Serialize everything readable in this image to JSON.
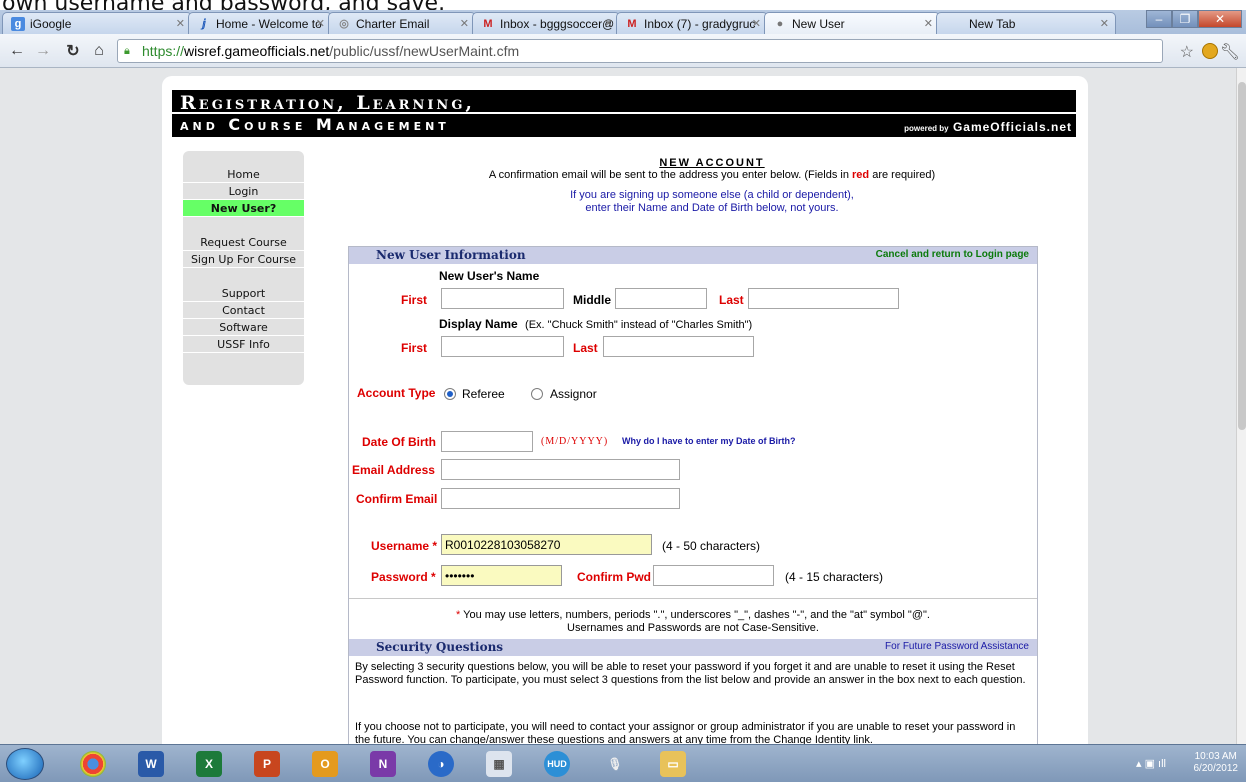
{
  "top_caption": "own username and password, and save.",
  "browser": {
    "tabs": [
      {
        "label": "iGoogle",
        "icon": "igoogle-icon",
        "active": false
      },
      {
        "label": "Home - Welcome to",
        "icon": "welcome-icon",
        "active": false
      },
      {
        "label": "Charter Email",
        "icon": "charter-icon",
        "active": false
      },
      {
        "label": "Inbox - bgggsoccer@",
        "icon": "gmail-icon",
        "active": false
      },
      {
        "label": "Inbox (7) - gradygruc",
        "icon": "gmail-icon",
        "active": false
      },
      {
        "label": "New User",
        "icon": "page-icon",
        "active": true
      },
      {
        "label": "New Tab",
        "icon": "",
        "active": false
      }
    ],
    "url_scheme": "https://",
    "url_host": "wisref.gameofficials.net",
    "url_path": "/public/ussf/newUserMaint.cfm"
  },
  "banner": {
    "line1": "Registration, Learning,",
    "line2": "and Course Management",
    "powered_prefix": "powered by",
    "powered_brand": "GameOfficials.net"
  },
  "nav": {
    "group1": [
      "Home",
      "Login",
      "New User?"
    ],
    "group2": [
      "Request Course",
      "Sign Up For Course"
    ],
    "group3": [
      "Support",
      "Contact",
      "Software",
      "USSF Info"
    ]
  },
  "header": {
    "title": "NEW ACCOUNT",
    "intro_pre": "A confirmation email will be sent to the address you enter below. (Fields in",
    "intro_red": "red",
    "intro_post": "are required)",
    "note_line1": "If you are signing up someone else (a child or dependent),",
    "note_line2": "enter their Name and Date of Birth below, not yours."
  },
  "form": {
    "section_title": "New User Information",
    "cancel_link": "Cancel and return to Login page",
    "users_name_label": "New User's Name",
    "first_label": "First",
    "middle_label": "Middle",
    "last_label": "Last",
    "display_name_label": "Display Name",
    "display_name_hint": "(Ex. \"Chuck Smith\" instead of \"Charles Smith\")",
    "display_first_label": "First",
    "display_last_label": "Last",
    "account_type_label": "Account Type",
    "account_type_options": [
      "Referee",
      "Assignor"
    ],
    "account_type_selected": "Referee",
    "dob_label": "Date Of Birth",
    "dob_format": "(M/D/YYYY)",
    "dob_why": "Why do I have to enter my Date of Birth?",
    "email_label": "Email Address",
    "confirm_email_label": "Confirm Email",
    "username_label": "Username",
    "username_value": "R0010228103058270",
    "username_hint": "(4 - 50 characters)",
    "password_label": "Password",
    "password_value": "•••••••",
    "confirm_pwd_label": "Confirm Pwd",
    "password_hint": "(4 - 15 characters)",
    "required_marker": "*",
    "rules_line1": "You may use letters, numbers, periods \".\", underscores \"_\", dashes \"-\", and the \"at\" symbol \"@\".",
    "rules_line2": "Usernames and Passwords are not Case-Sensitive."
  },
  "security": {
    "title": "Security Questions",
    "right_label": "For Future Password Assistance",
    "para1": "By selecting 3 security questions below, you will be able to reset your password if you forget it and are unable to reset it using the Reset Password function. To participate, you must select 3 questions from the list below and provide an answer in the box next to each question.",
    "para2": "If you choose not to participate, you will need to contact your assignor or group administrator if you are unable to reset your password in the future. You can change/answer these questions and answers at any time from the Change Identity link."
  },
  "taskbar": {
    "time": "10:03 AM",
    "date": "6/20/2012"
  }
}
